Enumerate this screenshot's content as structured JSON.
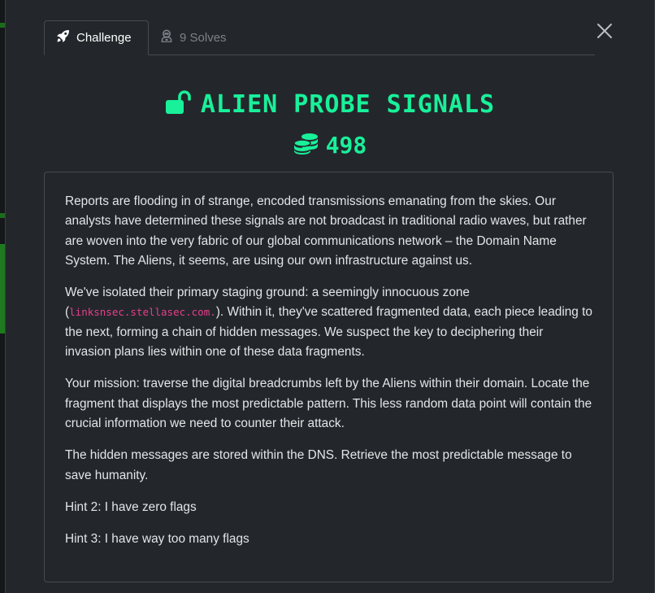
{
  "tabs": {
    "challenge_label": "Challenge",
    "solves_label": "9 Solves"
  },
  "challenge": {
    "title": "ALIEN PROBE SIGNALS",
    "points": "498"
  },
  "description": {
    "p1": "Reports are flooding in of strange, encoded transmissions emanating from the skies. Our analysts have determined these signals are not broadcast in traditional radio waves, but rather are woven into the very fabric of our global communications network – the Domain Name System. The Aliens, it seems, are using our own infrastructure against us.",
    "p2_before": "We've isolated their primary staging ground: a seemingly innocuous zone (",
    "p2_code": "linksnsec.stellasec.com.",
    "p2_after": "). Within it, they've scattered fragmented data, each piece leading to the next, forming a chain of hidden messages. We suspect the key to deciphering their invasion plans lies within one of these data fragments.",
    "p3": "Your mission: traverse the digital breadcrumbs left by the Aliens within their domain. Locate the fragment that displays the most predictable pattern. This less random data point will contain the crucial information we need to counter their attack.",
    "p4": "The hidden messages are stored within the DNS. Retrieve the most predictable message to save humanity.",
    "p5": "Hint 2: I have zero flags",
    "p6": "Hint 3: I have way too many flags"
  },
  "icons": {
    "challenge_tab": "rocket-icon",
    "solves_tab": "user-astronaut-icon",
    "title": "unlock-icon",
    "points": "coins-icon",
    "close": "close-icon"
  },
  "colors": {
    "accent": "#19f09a",
    "code": "#e83e8c",
    "background": "#23272b"
  }
}
